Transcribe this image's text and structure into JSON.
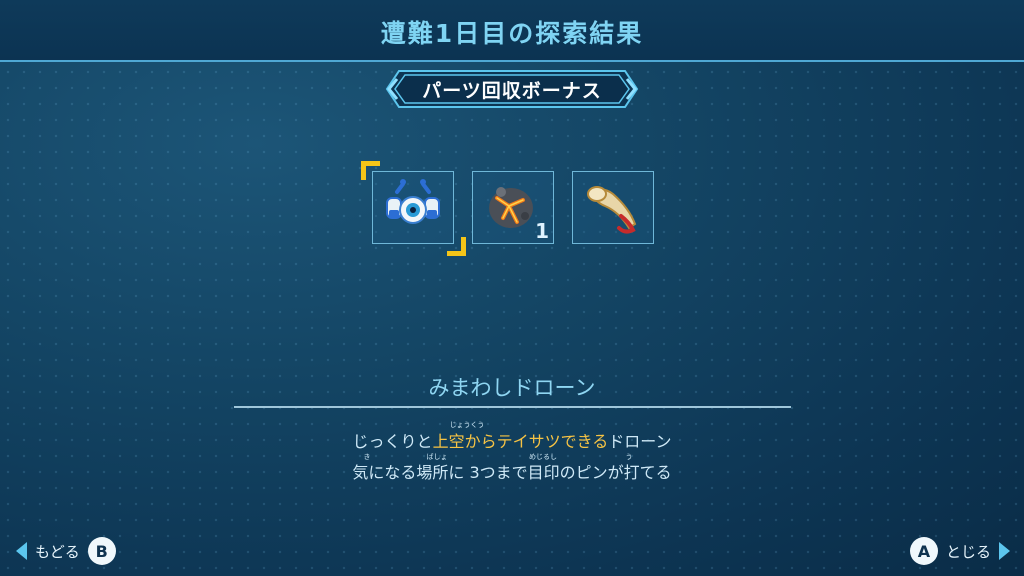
{
  "header": {
    "title": "遭難1日目の探索結果"
  },
  "banner": {
    "label": "パーツ回収ボーナス"
  },
  "items": [
    {
      "icon": "scout-drone-icon",
      "count": "",
      "selected": true
    },
    {
      "icon": "lava-rock-icon",
      "count": "1",
      "selected": false
    },
    {
      "icon": "horn-icon",
      "count": "",
      "selected": false
    }
  ],
  "detail": {
    "name": "みまわしドローン",
    "line1": {
      "pre": "じっくりと",
      "highlight": "上空からテイサツできる",
      "post": "ドローン",
      "ruby": "じょうくう"
    },
    "line2": {
      "text": "気になる場所に 3つまで目印のピンが打てる",
      "ruby_ki": "き",
      "ruby_basho": "ばしょ",
      "ruby_mejirushi": "めじるし",
      "ruby_u": "う"
    }
  },
  "footer": {
    "back_label": "もどる",
    "back_button": "B",
    "close_label": "とじる",
    "close_button": "A"
  },
  "colors": {
    "accent": "#f5c518",
    "title": "#7fd4f3",
    "highlight": "#f6c344"
  }
}
